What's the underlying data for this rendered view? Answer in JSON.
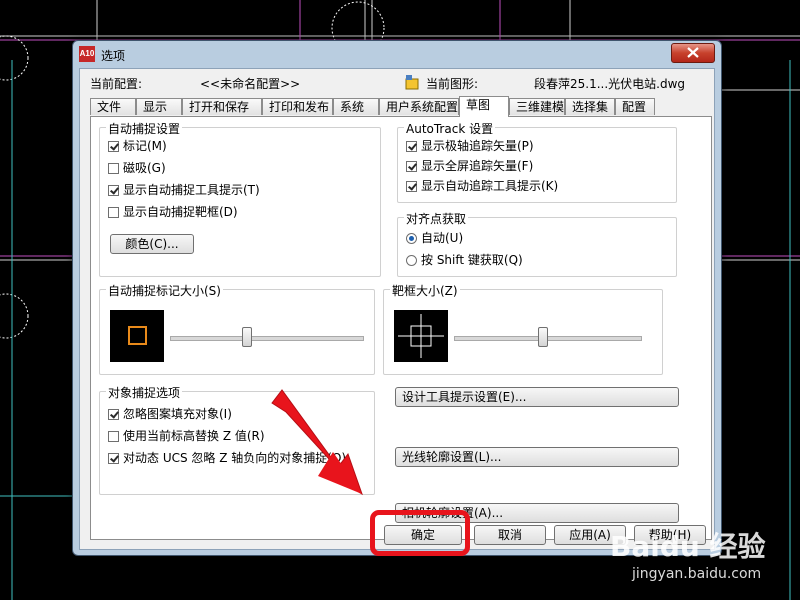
{
  "window": {
    "title": "选项",
    "app_badge": "A10"
  },
  "config": {
    "current_profile_label": "当前配置:",
    "current_profile_value": "<<未命名配置>>",
    "current_drawing_label": "当前图形:",
    "current_drawing_value": "段春萍25.1...光伏电站.dwg"
  },
  "tabs": [
    {
      "label": "文件"
    },
    {
      "label": "显示"
    },
    {
      "label": "打开和保存"
    },
    {
      "label": "打印和发布"
    },
    {
      "label": "系统"
    },
    {
      "label": "用户系统配置"
    },
    {
      "label": "草图",
      "active": true
    },
    {
      "label": "三维建模"
    },
    {
      "label": "选择集"
    },
    {
      "label": "配置"
    }
  ],
  "autosnap": {
    "title": "自动捕捉设置",
    "items": [
      {
        "label": "标记(M)",
        "checked": true
      },
      {
        "label": "磁吸(G)",
        "checked": false
      },
      {
        "label": "显示自动捕捉工具提示(T)",
        "checked": true
      },
      {
        "label": "显示自动捕捉靶框(D)",
        "checked": false
      }
    ],
    "color_button": "颜色(C)..."
  },
  "autotrack": {
    "title": "AutoTrack 设置",
    "items": [
      {
        "label": "显示极轴追踪矢量(P)",
        "checked": true
      },
      {
        "label": "显示全屏追踪矢量(F)",
        "checked": true
      },
      {
        "label": "显示自动追踪工具提示(K)",
        "checked": true
      }
    ]
  },
  "alignment": {
    "title": "对齐点获取",
    "options": [
      {
        "label": "自动(U)",
        "checked": true
      },
      {
        "label": "按 Shift 键获取(Q)",
        "checked": false
      }
    ]
  },
  "marker_size": {
    "title": "自动捕捉标记大小(S)",
    "level": 0.4
  },
  "aperture_size": {
    "title": "靶框大小(Z)",
    "level": 0.48
  },
  "osnap_options": {
    "title": "对象捕捉选项",
    "items": [
      {
        "label": "忽略图案填充对象(I)",
        "checked": true
      },
      {
        "label": "使用当前标高替换 Z 值(R)",
        "checked": false
      },
      {
        "label": "对动态 UCS 忽略 Z 轴负向的对象捕捉(O)",
        "checked": true
      }
    ]
  },
  "side_buttons": {
    "tooltip": "设计工具提示设置(E)...",
    "lightglyph": "光线轮廓设置(L)...",
    "camera": "相机轮廓设置(A)..."
  },
  "footer": {
    "ok": "确定",
    "cancel": "取消",
    "apply": "应用(A)",
    "help": "帮助(H)"
  },
  "watermark": {
    "brand": "Baidu 经验",
    "url": "jingyan.baidu.com"
  },
  "colors": {
    "highlight": "#e8141c",
    "marker": "#e88a1a",
    "title_bar": "#b9cde0"
  }
}
